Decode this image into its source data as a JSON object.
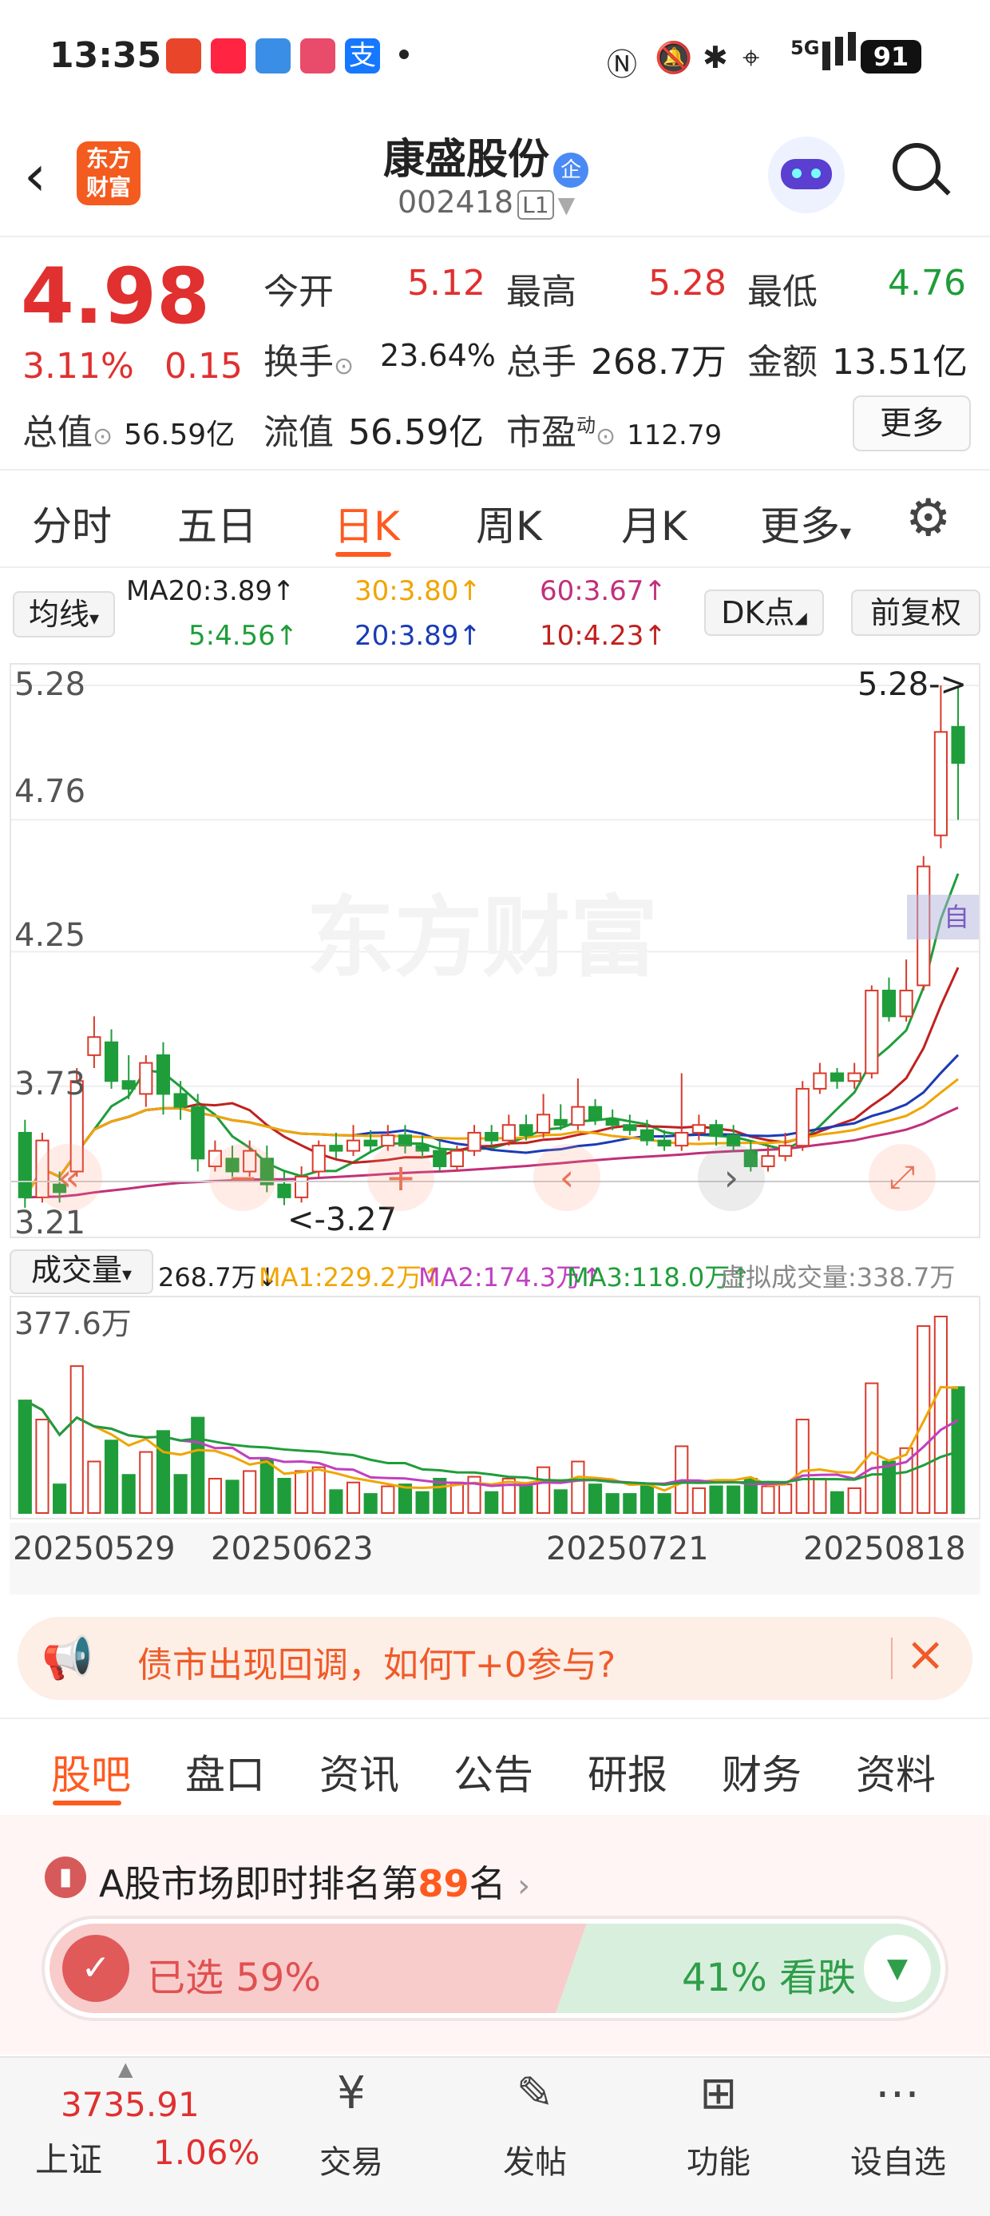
{
  "status_bar": {
    "time": "13:35",
    "battery": "91",
    "signal": "5G"
  },
  "header": {
    "logo_text": "东方财富",
    "name": "康盛股份",
    "badge": "企",
    "code": "002418",
    "level": "L1"
  },
  "quote": {
    "price": "4.98",
    "change_pct": "3.11%",
    "change": "0.15",
    "open_label": "今开",
    "open": "5.12",
    "high_label": "最高",
    "high": "5.28",
    "low_label": "最低",
    "low": "4.76",
    "turnover_label": "换手",
    "turnover": "23.64%",
    "volume_label": "总手",
    "volume": "268.7万",
    "amount_label": "金额",
    "amount": "13.51亿",
    "mktcap_label": "总值",
    "mktcap": "56.59亿",
    "float_label": "流值",
    "float": "56.59亿",
    "pe_label": "市盈",
    "pe_sup": "动",
    "pe": "112.79",
    "more": "更多"
  },
  "tabs": [
    "分时",
    "五日",
    "日K",
    "周K",
    "月K",
    "更多"
  ],
  "active_tab": "日K",
  "ma_row": {
    "select": "均线",
    "ma20a": "MA20:3.89↑",
    "ma30": "30:3.80↑",
    "ma60": "60:3.67↑",
    "ma5": "5:4.56↑",
    "ma20": "20:3.89↑",
    "ma10": "10:4.23↑",
    "dk": "DK点",
    "fq": "前复权"
  },
  "kchart": {
    "y_labels": [
      "5.28",
      "4.76",
      "4.25",
      "3.73",
      "3.21"
    ],
    "high_mark": "5.28->",
    "low_mark": "<-3.27",
    "watermark": "东方财富",
    "self_mark": "自"
  },
  "volume_row": {
    "select": "成交量",
    "vol": "268.7万↓",
    "ma1": "MA1:229.2万↑",
    "ma2": "MA2:174.3万↑",
    "ma3": "MA3:118.0万↑",
    "virtual": "虚拟成交量:338.7万",
    "max": "377.6万"
  },
  "dates": [
    "20250529",
    "20250623",
    "20250721",
    "20250818"
  ],
  "banner": {
    "text": "债市出现回调，如何T+0参与?"
  },
  "sub_tabs": [
    "股吧",
    "盘口",
    "资讯",
    "公告",
    "研报",
    "财务",
    "资料"
  ],
  "rank": {
    "prefix": "A股市场即时排名第",
    "num": "89",
    "suffix": "名"
  },
  "vote": {
    "up": "已选 59%",
    "down": "41% 看跌"
  },
  "bottom": {
    "index_val": "3735.91",
    "index_name": "上证",
    "index_pct": "1.06%",
    "items": [
      "交易",
      "发帖",
      "功能",
      "设自选"
    ]
  },
  "chart_data": {
    "type": "candlestick",
    "ylim": [
      3.21,
      5.28
    ],
    "candles": [
      [
        3.55,
        3.3,
        3.6,
        3.26
      ],
      [
        3.3,
        3.52,
        3.55,
        3.28
      ],
      [
        3.35,
        3.32,
        3.4,
        3.28
      ],
      [
        3.4,
        3.75,
        3.8,
        3.38
      ],
      [
        3.85,
        3.92,
        4.0,
        3.8
      ],
      [
        3.9,
        3.75,
        3.95,
        3.72
      ],
      [
        3.75,
        3.72,
        3.85,
        3.68
      ],
      [
        3.7,
        3.82,
        3.85,
        3.65
      ],
      [
        3.85,
        3.7,
        3.9,
        3.62
      ],
      [
        3.7,
        3.65,
        3.75,
        3.6
      ],
      [
        3.65,
        3.45,
        3.7,
        3.4
      ],
      [
        3.42,
        3.48,
        3.52,
        3.4
      ],
      [
        3.45,
        3.4,
        3.5,
        3.38
      ],
      [
        3.4,
        3.48,
        3.52,
        3.38
      ],
      [
        3.45,
        3.35,
        3.5,
        3.32
      ],
      [
        3.35,
        3.3,
        3.4,
        3.27
      ],
      [
        3.3,
        3.38,
        3.42,
        3.28
      ],
      [
        3.4,
        3.5,
        3.52,
        3.38
      ],
      [
        3.5,
        3.48,
        3.55,
        3.45
      ],
      [
        3.48,
        3.52,
        3.58,
        3.46
      ],
      [
        3.52,
        3.5,
        3.56,
        3.48
      ],
      [
        3.5,
        3.54,
        3.58,
        3.48
      ],
      [
        3.54,
        3.5,
        3.58,
        3.47
      ],
      [
        3.5,
        3.48,
        3.54,
        3.45
      ],
      [
        3.48,
        3.42,
        3.52,
        3.4
      ],
      [
        3.42,
        3.48,
        3.5,
        3.4
      ],
      [
        3.48,
        3.55,
        3.58,
        3.46
      ],
      [
        3.55,
        3.52,
        3.58,
        3.5
      ],
      [
        3.52,
        3.58,
        3.62,
        3.5
      ],
      [
        3.58,
        3.54,
        3.62,
        3.52
      ],
      [
        3.55,
        3.62,
        3.7,
        3.53
      ],
      [
        3.6,
        3.58,
        3.66,
        3.56
      ],
      [
        3.58,
        3.65,
        3.76,
        3.56
      ],
      [
        3.65,
        3.6,
        3.68,
        3.58
      ],
      [
        3.6,
        3.58,
        3.64,
        3.56
      ],
      [
        3.58,
        3.56,
        3.62,
        3.54
      ],
      [
        3.56,
        3.52,
        3.6,
        3.5
      ],
      [
        3.52,
        3.5,
        3.56,
        3.48
      ],
      [
        3.5,
        3.55,
        3.78,
        3.48
      ],
      [
        3.55,
        3.58,
        3.62,
        3.52
      ],
      [
        3.58,
        3.54,
        3.6,
        3.5
      ],
      [
        3.54,
        3.5,
        3.58,
        3.48
      ],
      [
        3.48,
        3.42,
        3.52,
        3.4
      ],
      [
        3.42,
        3.46,
        3.5,
        3.4
      ],
      [
        3.46,
        3.5,
        3.55,
        3.44
      ],
      [
        3.5,
        3.72,
        3.75,
        3.48
      ],
      [
        3.72,
        3.78,
        3.82,
        3.7
      ],
      [
        3.78,
        3.75,
        3.8,
        3.72
      ],
      [
        3.75,
        3.78,
        3.82,
        3.72
      ],
      [
        3.78,
        4.1,
        4.12,
        3.76
      ],
      [
        4.1,
        4.0,
        4.15,
        3.98
      ],
      [
        4.0,
        4.1,
        4.22,
        3.98
      ],
      [
        4.12,
        4.58,
        4.62,
        4.1
      ],
      [
        4.7,
        5.1,
        5.28,
        4.65
      ],
      [
        5.12,
        4.98,
        5.28,
        4.76
      ]
    ]
  }
}
